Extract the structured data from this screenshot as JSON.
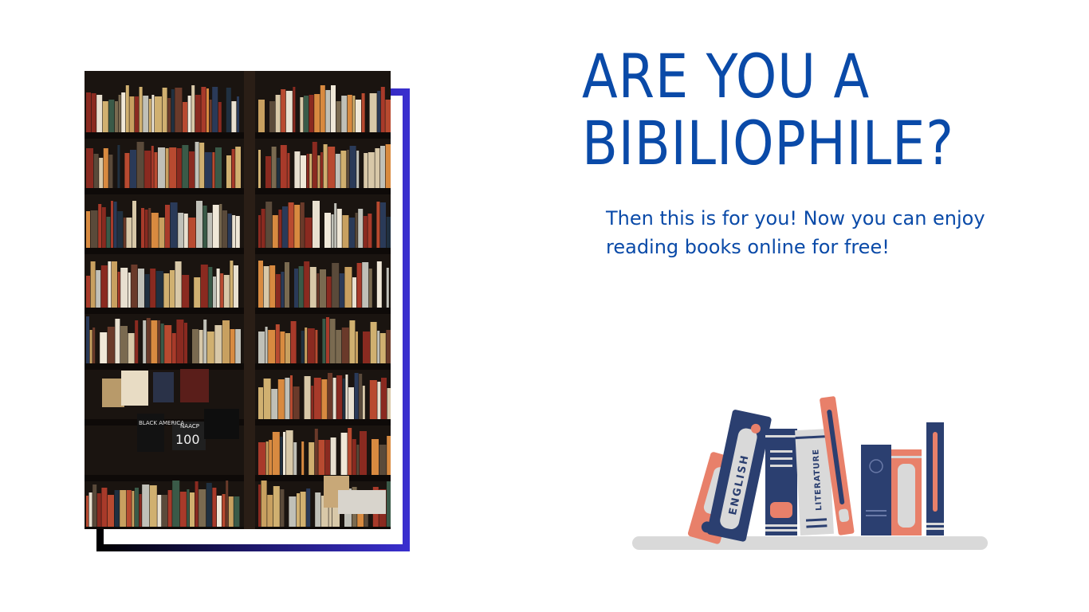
{
  "slide": {
    "headline": "ARE YOU A\nBIBILIOPHILE?",
    "subtext": "Then this is for you! Now you can enjoy reading books online for free!"
  },
  "illustration": {
    "book_labels": {
      "english": "ENGLISH",
      "literature": "LITERATURE"
    }
  },
  "photo": {
    "visible_titles": {
      "title_1": "BLACK AMERICA",
      "title_2": "NAACP",
      "title_3": "100"
    }
  },
  "colors": {
    "accent_blue": "#0a4aa8",
    "frame_gradient_start": "#000000",
    "frame_gradient_end": "#3a2fd0",
    "book_navy": "#2b3f70",
    "book_coral": "#e8806a",
    "book_light_grey": "#d9d9d9",
    "shelf_grey": "#d9d9d9"
  }
}
